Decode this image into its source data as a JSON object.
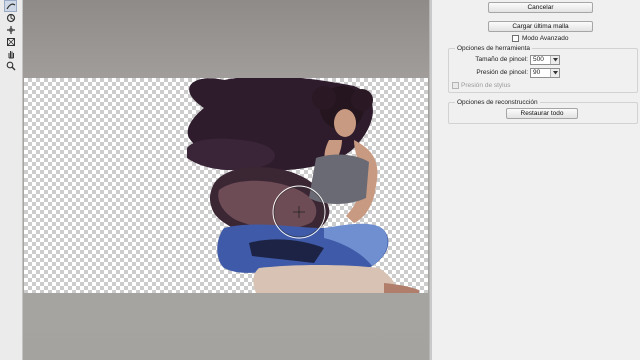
{
  "toolbar": {
    "tools": [
      {
        "name": "forward-warp-tool",
        "icon": "warp-icon"
      },
      {
        "name": "reconstruct-tool",
        "icon": "reconstruct-icon"
      },
      {
        "name": "pucker-tool",
        "icon": "pucker-icon"
      },
      {
        "name": "bloat-tool",
        "icon": "bloat-icon"
      },
      {
        "name": "hand-tool",
        "icon": "hand-icon"
      },
      {
        "name": "zoom-tool",
        "icon": "zoom-icon"
      }
    ]
  },
  "panel": {
    "cancel_label": "Cancelar",
    "load_mesh_label": "Cargar última malla",
    "advanced_mode_label": "Modo Avanzado",
    "advanced_mode_checked": false,
    "tool_options": {
      "title": "Opciones de herramienta",
      "brush_size_label": "Tamaño de pincel:",
      "brush_size_value": "500",
      "brush_pressure_label": "Presión de pincel:",
      "brush_pressure_value": "90",
      "stylus_pressure_label": "Presión de stylus",
      "stylus_pressure_checked": false,
      "stylus_pressure_enabled": false
    },
    "reconstruct_options": {
      "title": "Opciones de reconstrucción",
      "restore_all_label": "Restaurar todo"
    }
  },
  "colors": {
    "hair": "#2e1c2c",
    "skin": "#c99a82",
    "top": "#6a6a74",
    "skirt": "#3f5aa8",
    "skirt_light": "#6f8fd0",
    "legs": "#d8c2b3"
  }
}
